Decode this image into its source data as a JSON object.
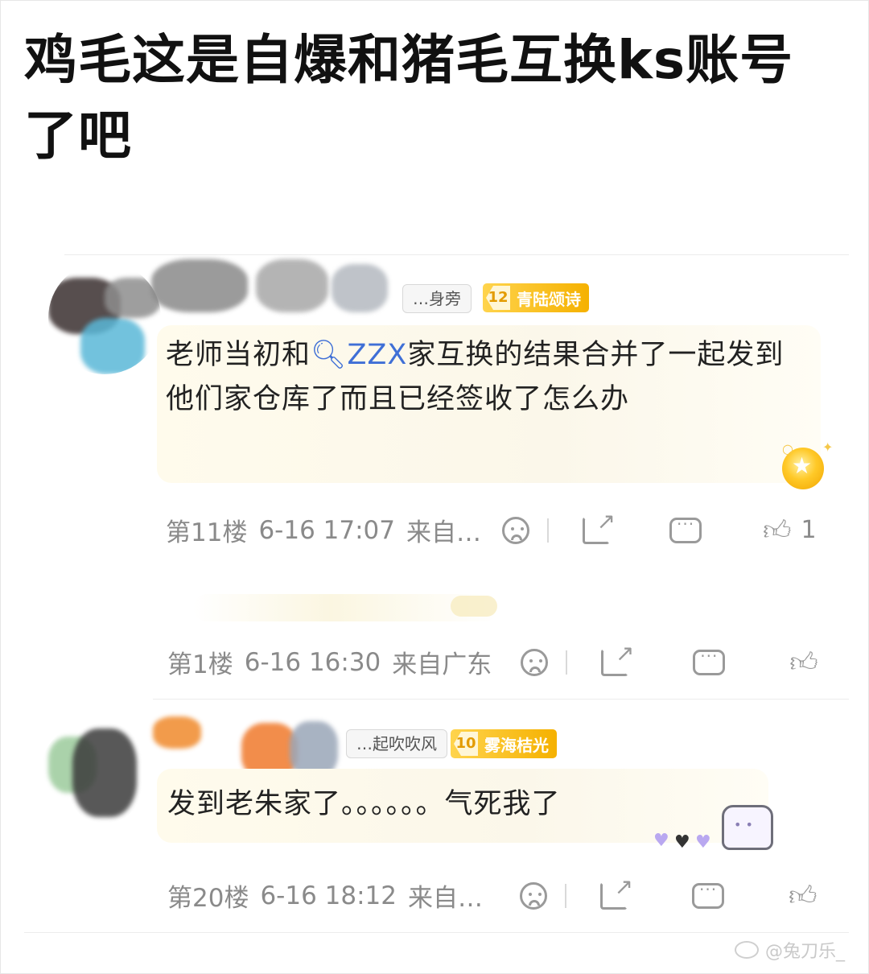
{
  "headline": "鸡毛这是自爆和猪毛互换ks账号了吧",
  "comments": [
    {
      "username_fragment": "…身旁",
      "level": "12",
      "level_title": "青陆颂诗",
      "text_before_mention": "老师当初和",
      "mention": "ZZX",
      "text_after_mention": "家互换的结果合并了一起发到他们家仓库了而且已经签收了怎么办",
      "floor": "第11楼",
      "time": "6-16 17:07",
      "location": "来自…",
      "likes": "1"
    },
    {
      "floor": "第1楼",
      "time": "6-16 16:30",
      "location": "来自广东"
    },
    {
      "username_fragment": "…起吹吹风",
      "level": "10",
      "level_title": "雾海桔光",
      "text": "发到老朱家了。。。。。。气死我了",
      "floor": "第20楼",
      "time": "6-16 18:12",
      "location": "来自…"
    }
  ],
  "watermark": "@兔刀乐_",
  "colors": {
    "mention": "#3f6fd6",
    "level_badge": "#f5b100",
    "meta_text": "#8a8a8a"
  },
  "icons": [
    "sad-face-icon",
    "share-icon",
    "comment-icon",
    "thumbs-up-icon",
    "search-icon",
    "weibo-logo-icon"
  ]
}
